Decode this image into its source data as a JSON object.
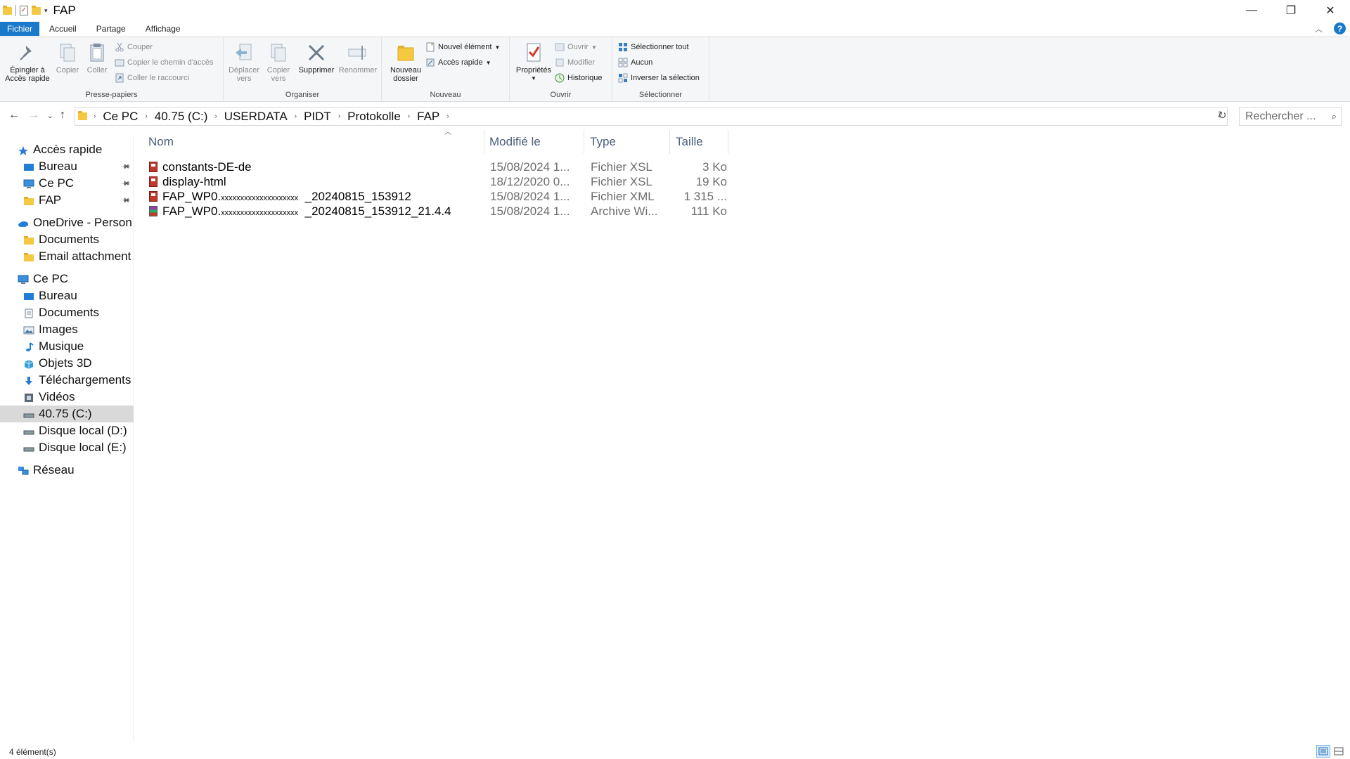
{
  "window": {
    "title": "FAP",
    "minimize": "—",
    "maximize": "❐",
    "close": "✕"
  },
  "ribbon_tabs": [
    "Fichier",
    "Accueil",
    "Partage",
    "Affichage"
  ],
  "ribbon": {
    "clipboard": {
      "label": "Presse-papiers",
      "pin": "Épingler à\nAccès rapide",
      "copy": "Copier",
      "paste": "Coller",
      "cut": "Couper",
      "copy_path": "Copier le chemin d'accès",
      "paste_shortcut": "Coller le raccourci"
    },
    "organize": {
      "label": "Organiser",
      "move_to": "Déplacer\nvers",
      "copy_to": "Copier\nvers",
      "delete": "Supprimer",
      "rename": "Renommer"
    },
    "new": {
      "label": "Nouveau",
      "new_folder": "Nouveau\ndossier",
      "new_item": "Nouvel élément",
      "quick_access": "Accès rapide"
    },
    "open": {
      "label": "Ouvrir",
      "properties": "Propriétés",
      "open": "Ouvrir",
      "edit": "Modifier",
      "history": "Historique"
    },
    "select": {
      "label": "Sélectionner",
      "select_all": "Sélectionner tout",
      "select_none": "Aucun",
      "invert": "Inverser la sélection"
    }
  },
  "address": {
    "crumbs": [
      "Ce PC",
      "40.75 (C:)",
      "USERDATA",
      "PIDT",
      "Protokolle",
      "FAP"
    ],
    "search_placeholder": "Rechercher ..."
  },
  "nav": [
    {
      "label": "Accès rapide",
      "icon": "star-icon",
      "level": 0,
      "pinned": false
    },
    {
      "label": "Bureau",
      "icon": "desktop-icon",
      "level": 1,
      "pinned": true
    },
    {
      "label": "Ce PC",
      "icon": "computer-icon",
      "level": 1,
      "pinned": true
    },
    {
      "label": "FAP",
      "icon": "folder-icon",
      "level": 1,
      "pinned": true
    },
    {
      "label": "OneDrive - Person",
      "icon": "cloud-icon",
      "level": 0,
      "pinned": false
    },
    {
      "label": "Documents",
      "icon": "folder-icon",
      "level": 1,
      "pinned": false
    },
    {
      "label": "Email attachment",
      "icon": "folder-icon",
      "level": 1,
      "pinned": false
    },
    {
      "label": "Ce PC",
      "icon": "computer-icon",
      "level": 0,
      "pinned": false
    },
    {
      "label": "Bureau",
      "icon": "desktop-icon",
      "level": 1,
      "pinned": false
    },
    {
      "label": "Documents",
      "icon": "documents-icon",
      "level": 1,
      "pinned": false
    },
    {
      "label": "Images",
      "icon": "pictures-icon",
      "level": 1,
      "pinned": false
    },
    {
      "label": "Musique",
      "icon": "music-icon",
      "level": 1,
      "pinned": false
    },
    {
      "label": "Objets 3D",
      "icon": "objects3d-icon",
      "level": 1,
      "pinned": false
    },
    {
      "label": "Téléchargements",
      "icon": "downloads-icon",
      "level": 1,
      "pinned": false
    },
    {
      "label": "Vidéos",
      "icon": "videos-icon",
      "level": 1,
      "pinned": false
    },
    {
      "label": "40.75 (C:)",
      "icon": "drive-icon",
      "level": 1,
      "pinned": false,
      "selected": true
    },
    {
      "label": "Disque local (D:)",
      "icon": "drive-icon",
      "level": 1,
      "pinned": false
    },
    {
      "label": "Disque local (E:)",
      "icon": "drive-icon",
      "level": 1,
      "pinned": false
    },
    {
      "label": "Réseau",
      "icon": "network-icon",
      "level": 0,
      "pinned": false
    }
  ],
  "columns": {
    "name": "Nom",
    "modified": "Modifié le",
    "type": "Type",
    "size": "Taille"
  },
  "files": [
    {
      "name": "constants-DE-de",
      "name_censored": "",
      "name_suffix": "",
      "modified": "15/08/2024 1...",
      "type": "Fichier XSL",
      "size": "3 Ko",
      "icon": "xsl-file-icon"
    },
    {
      "name": "display-html",
      "name_censored": "",
      "name_suffix": "",
      "modified": "18/12/2020 0...",
      "type": "Fichier XSL",
      "size": "19 Ko",
      "icon": "xsl-file-icon"
    },
    {
      "name": "FAP_WP0",
      "name_censored": "xxxxxxxxxxxxxxxxxxxx",
      "name_suffix": "_20240815_153912",
      "modified": "15/08/2024 1...",
      "type": "Fichier XML",
      "size": "1 315 ...",
      "icon": "xml-file-icon"
    },
    {
      "name": "FAP_WP0",
      "name_censored": "xxxxxxxxxxxxxxxxxxxx",
      "name_suffix": "_20240815_153912_21.4.4",
      "modified": "15/08/2024 1...",
      "type": "Archive Wi...",
      "size": "111 Ko",
      "icon": "rar-archive-icon"
    }
  ],
  "status": {
    "count": "4 élément(s)"
  }
}
